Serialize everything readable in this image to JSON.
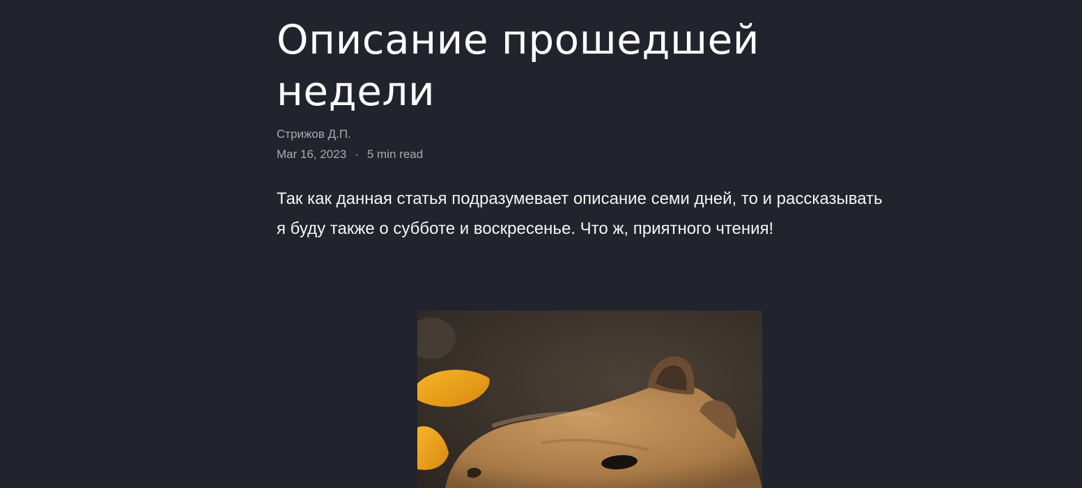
{
  "article": {
    "title": "Описание прошедшей недели",
    "author": "Стрижов Д.П.",
    "date": "Mar 16, 2023",
    "separator": "·",
    "read_time": "5 min read",
    "lead": "Так как данная статья подразумевает описание семи дней, то и рассказывать я буду также о субботе и воскресенье. Что ж, приятного чтения!"
  },
  "image": {
    "subject": "capybara photo",
    "colors": {
      "background": "#3a322b",
      "fur": "#b98a55",
      "orange": "#f0a51e"
    }
  },
  "theme": {
    "page_background": "#22242d",
    "text": "#f4f4f4",
    "muted_text": "#a9abb3"
  }
}
